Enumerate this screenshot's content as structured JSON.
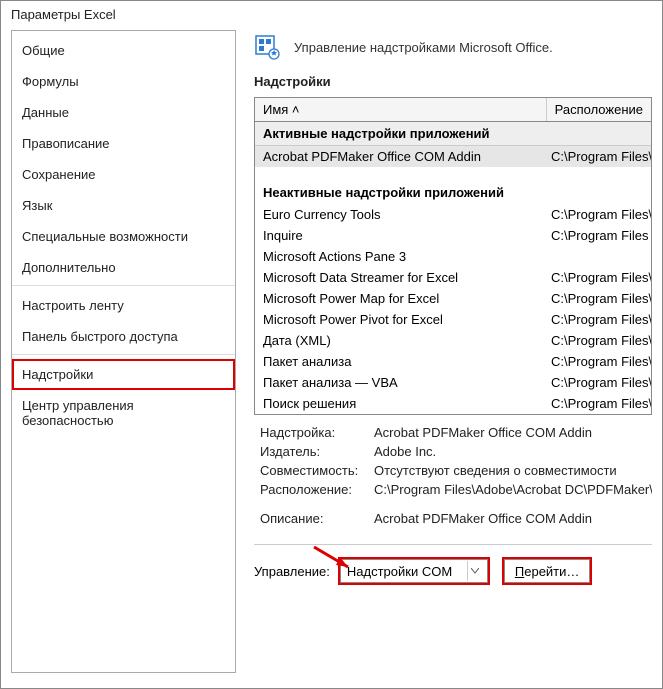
{
  "window": {
    "title": "Параметры Excel"
  },
  "sidebar": {
    "items": [
      {
        "label": "Общие"
      },
      {
        "label": "Формулы"
      },
      {
        "label": "Данные"
      },
      {
        "label": "Правописание"
      },
      {
        "label": "Сохранение"
      },
      {
        "label": "Язык"
      },
      {
        "label": "Специальные возможности"
      },
      {
        "label": "Дополнительно"
      },
      {
        "label": "Настроить ленту"
      },
      {
        "label": "Панель быстрого доступа"
      },
      {
        "label": "Надстройки"
      },
      {
        "label": "Центр управления безопасностью"
      }
    ]
  },
  "header": {
    "title": "Управление надстройками Microsoft Office."
  },
  "section": {
    "title": "Надстройки"
  },
  "grid": {
    "col_name": "Имя ˄",
    "col_loc": "Расположение",
    "group_active": "Активные надстройки приложений",
    "group_inactive": "Неактивные надстройки приложений",
    "active": [
      {
        "name": "Acrobat PDFMaker Office COM Addin",
        "loc": "C:\\Program Files\\A"
      }
    ],
    "inactive": [
      {
        "name": "Euro Currency Tools",
        "loc": "C:\\Program Files\\M"
      },
      {
        "name": "Inquire",
        "loc": "C:\\Program Files (x"
      },
      {
        "name": "Microsoft Actions Pane 3",
        "loc": ""
      },
      {
        "name": "Microsoft Data Streamer for Excel",
        "loc": "C:\\Program Files\\M"
      },
      {
        "name": "Microsoft Power Map for Excel",
        "loc": "C:\\Program Files\\M"
      },
      {
        "name": "Microsoft Power Pivot for Excel",
        "loc": "C:\\Program Files\\M"
      },
      {
        "name": "Дата (XML)",
        "loc": "C:\\Program Files\\C"
      },
      {
        "name": "Пакет анализа",
        "loc": "C:\\Program Files\\M"
      },
      {
        "name": "Пакет анализа — VBA",
        "loc": "C:\\Program Files\\M"
      },
      {
        "name": "Поиск решения",
        "loc": "C:\\Program Files\\M"
      }
    ]
  },
  "details": {
    "addin_label": "Надстройка:",
    "addin_value": "Acrobat PDFMaker Office COM Addin",
    "publisher_label": "Издатель:",
    "publisher_value": "Adobe Inc.",
    "compat_label": "Совместимость:",
    "compat_value": "Отсутствуют сведения о совместимости",
    "location_label": "Расположение:",
    "location_value": "C:\\Program Files\\Adobe\\Acrobat DC\\PDFMaker\\Office\\",
    "desc_label": "Описание:",
    "desc_value": "Acrobat PDFMaker Office COM Addin"
  },
  "footer": {
    "manage_label": "Управление:",
    "combo_value": "Надстройки COM",
    "go_prefix": "П",
    "go_rest": "ерейти…"
  }
}
